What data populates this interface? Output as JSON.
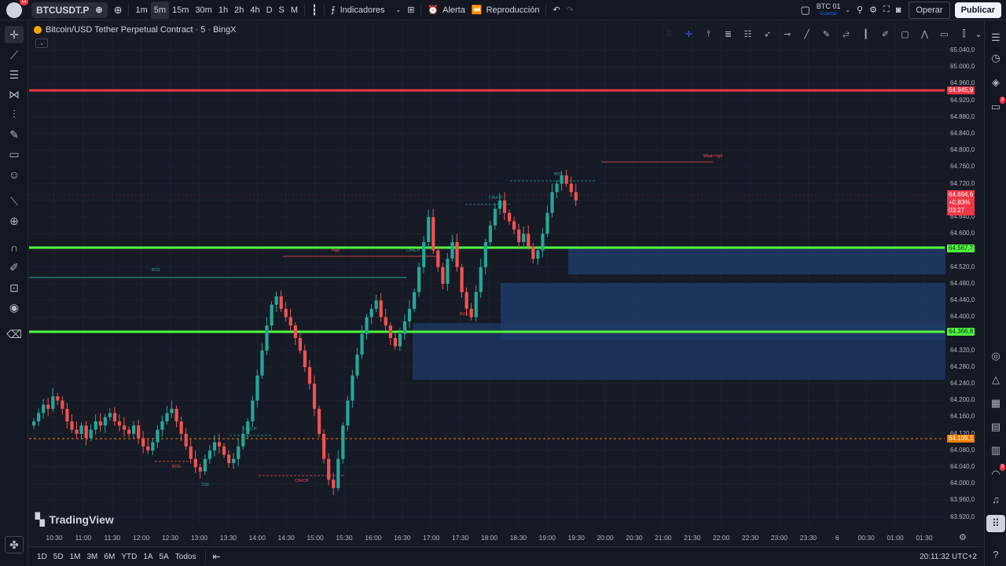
{
  "topbar": {
    "notifications_badge": "11",
    "symbol": "BTCUSDT.P",
    "intervals": [
      "1m",
      "5m",
      "15m",
      "30m",
      "1h",
      "2h",
      "4h",
      "D",
      "S",
      "M"
    ],
    "active_interval": "5m",
    "indicators_label": "Indicadores",
    "alert_label": "Alerta",
    "replay_label": "Reproducción",
    "layout_name": "BTC 01",
    "layout_status": "Guardar",
    "trade_label": "Operar",
    "publish_label": "Publicar"
  },
  "legend": {
    "title": "Bitcoin/USD Tether Perpetual Contract · 5 · BingX"
  },
  "branding": {
    "logo_text": "TradingView"
  },
  "price_axis": {
    "ticks": [
      "65.040,0",
      "65.000,0",
      "64.960,0",
      "64.920,0",
      "64.880,0",
      "64.840,0",
      "64.800,0",
      "64.760,0",
      "64.720,0",
      "64.680,0",
      "64.640,0",
      "64.600,0",
      "64.560,0",
      "64.520,0",
      "64.480,0",
      "64.440,0",
      "64.400,0",
      "64.360,0",
      "64.320,0",
      "64.280,0",
      "64.240,0",
      "64.200,0",
      "64.160,0",
      "64.120,0",
      "64.080,0",
      "64.040,0",
      "64.000,0",
      "63.960,0",
      "63.920,0"
    ],
    "tags": {
      "red_line": "64.945,9",
      "current_price": "64.694,6",
      "current_change": "+0,83%",
      "countdown": "03:27",
      "green_line_upper": "64.567,7",
      "green_line_lower": "64.366,8",
      "dotted_line": "64.109,1"
    }
  },
  "time_axis": {
    "ticks": [
      "10:30",
      "11:00",
      "11:30",
      "12:00",
      "12:30",
      "13:00",
      "13:30",
      "14:00",
      "14:30",
      "15:00",
      "15:30",
      "16:00",
      "16:30",
      "17:00",
      "17:30",
      "18:00",
      "18:30",
      "19:00",
      "19:30",
      "20:00",
      "20:30",
      "21:00",
      "21:30",
      "22:00",
      "22:30",
      "23:00",
      "23:30",
      "6",
      "00:30",
      "01:00",
      "01:30"
    ]
  },
  "annotations": {
    "bos_left": "BOS",
    "bos_top": "BOS",
    "choch_1": "CHoCH",
    "choch_2": "CHoCH",
    "choch_3": "CHoCH",
    "choch_4": "CHoCH",
    "bos_low": "BOS",
    "bos_mid": "BOS",
    "ssb": "SSB",
    "weak_high": "Weak High",
    "high": "High"
  },
  "bottombar": {
    "ranges": [
      "1D",
      "5D",
      "1M",
      "3M",
      "6M",
      "YTD",
      "1A",
      "5A",
      "Todos"
    ],
    "clock": "20:11:32 UTC+2"
  },
  "colors": {
    "background": "#131722",
    "up": "#26a69a",
    "down": "#ef5350",
    "green_line": "#4cff3a",
    "red_line": "#f23645",
    "zone": "#1e3a66",
    "dotted": "#f57c00"
  },
  "icons": {
    "left_tools": [
      "crosshair-icon",
      "trend-line-icon",
      "fib-icon",
      "pattern-icon",
      "forecast-icon",
      "brush-icon",
      "text-icon",
      "emoji-icon",
      "ruler-icon",
      "zoom-icon",
      "magnet-icon",
      "lock-drawing-icon",
      "lock-icon",
      "eye-icon",
      "trash-icon"
    ],
    "right_tools": [
      "watchlist-icon",
      "alerts-icon",
      "layers-icon",
      "chat-icon",
      "ideas-icon",
      "news-icon",
      "calendar-icon",
      "hotlist-icon",
      "screener-icon",
      "streams-icon",
      "notifications-icon",
      "grid-icon",
      "help-icon"
    ],
    "right_badges": [
      "3",
      "3"
    ]
  }
}
